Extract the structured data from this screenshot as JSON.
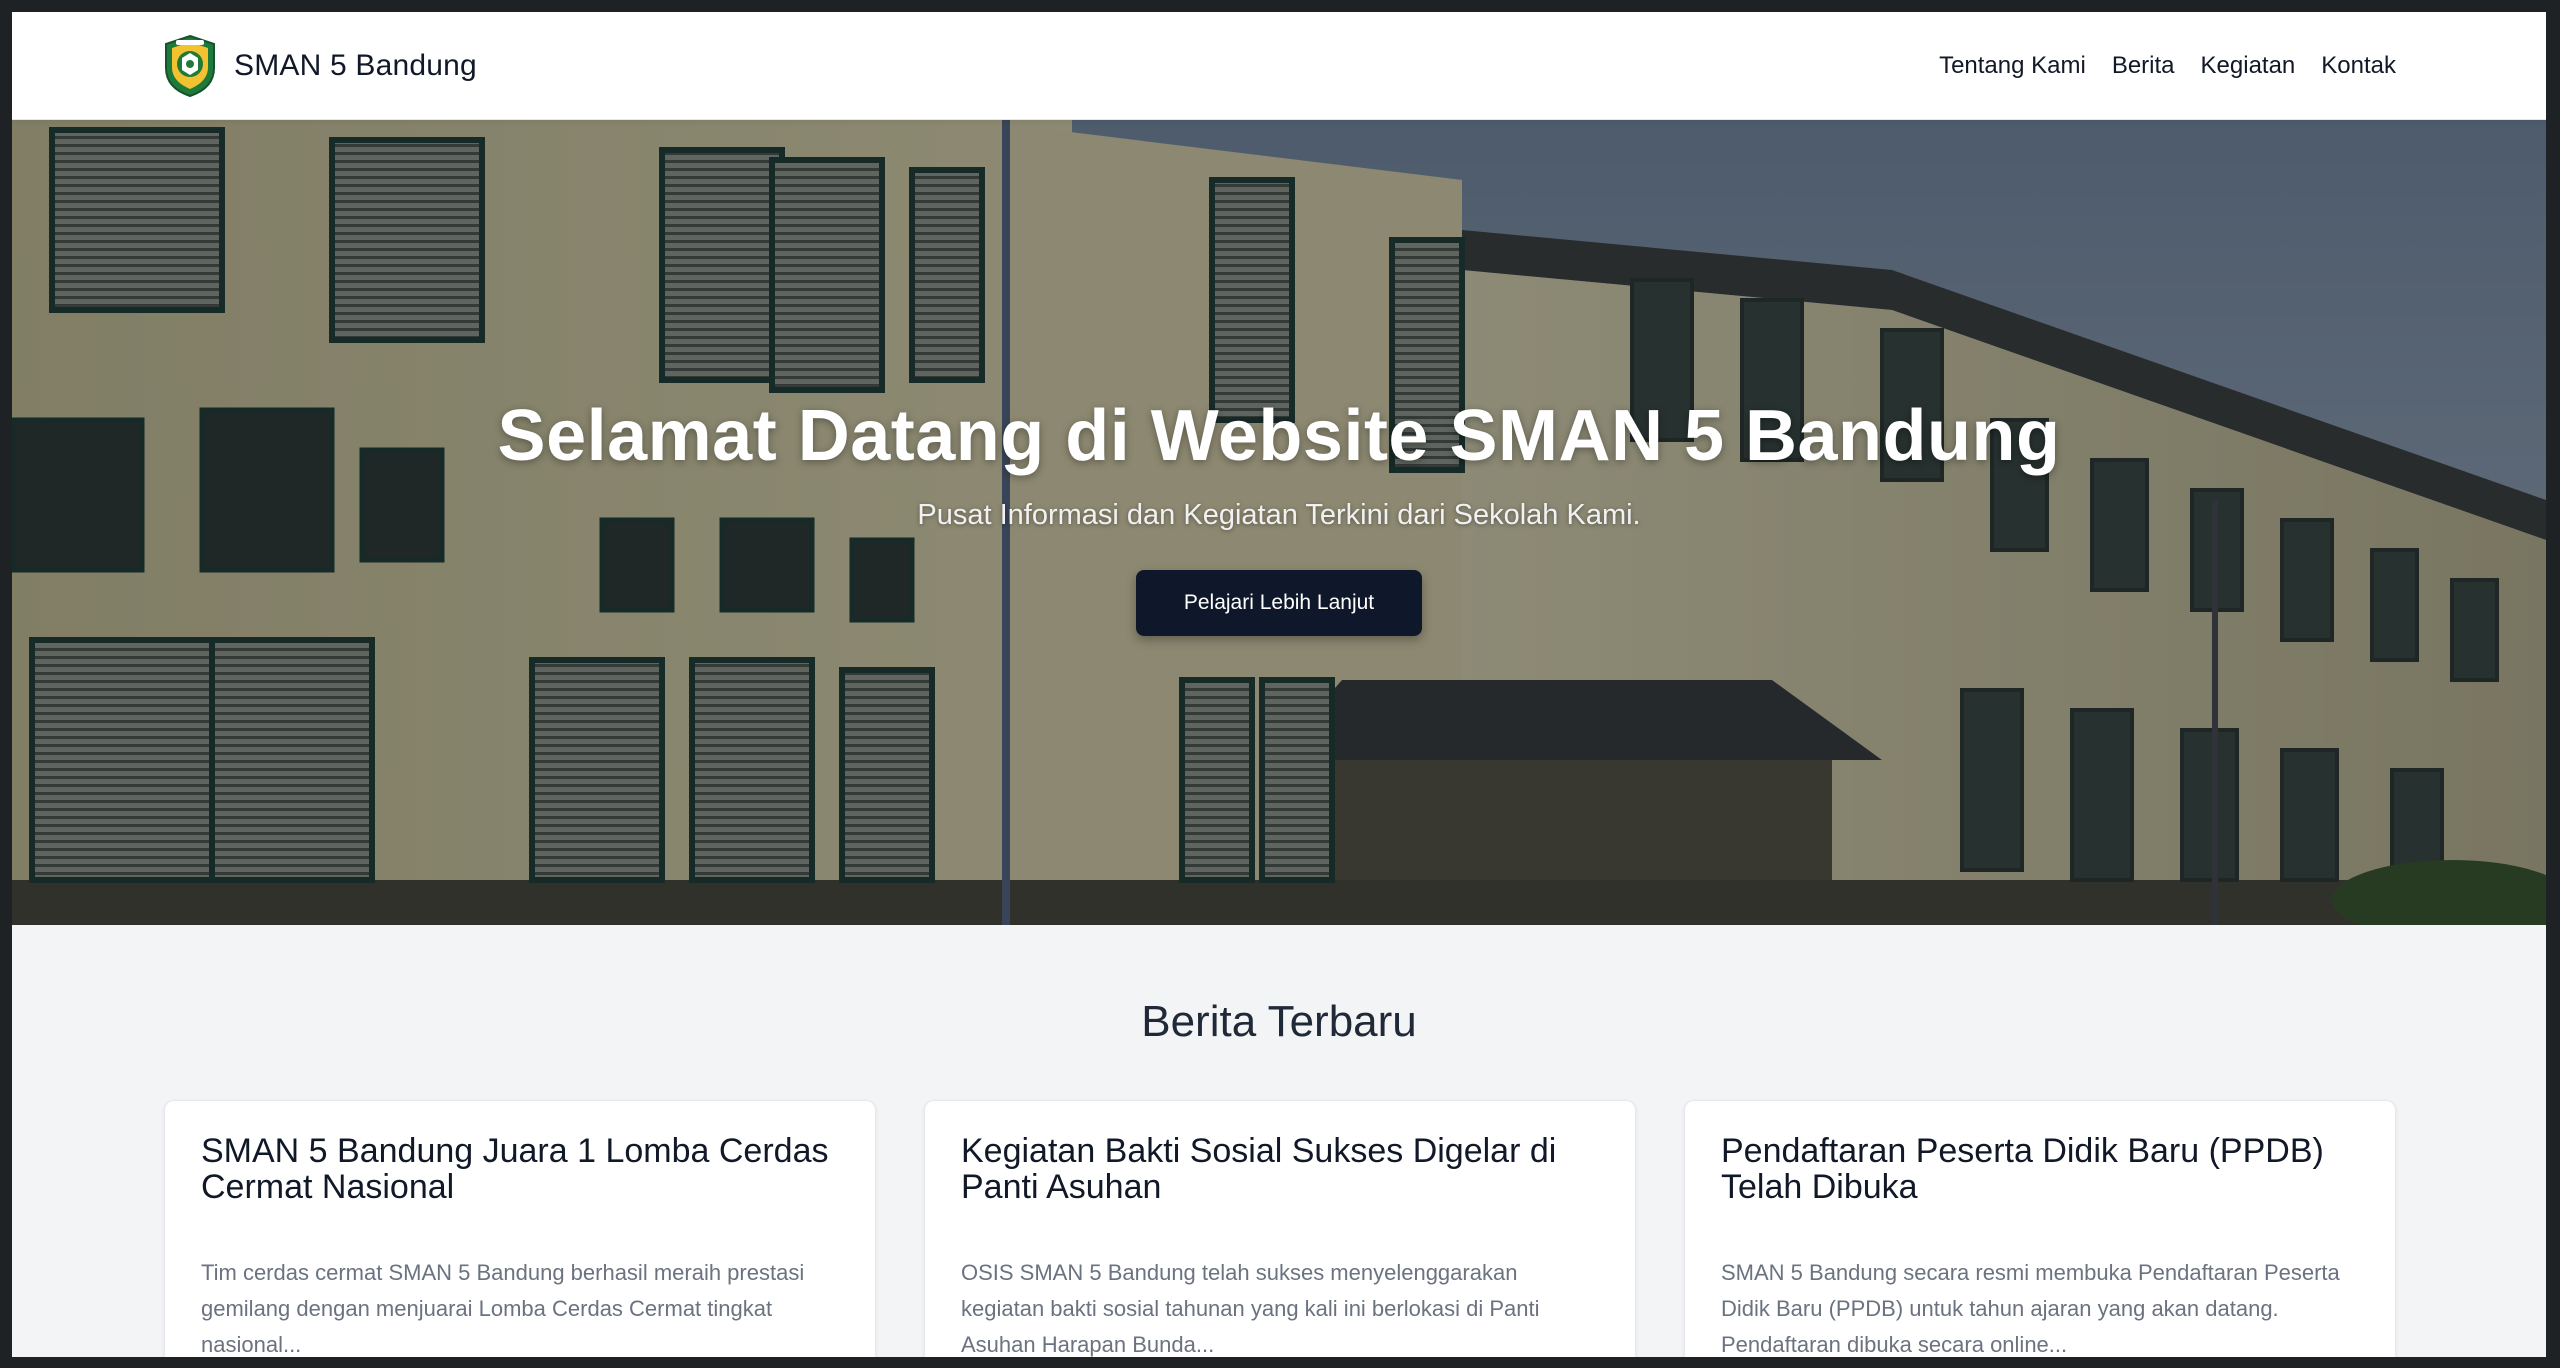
{
  "navbar": {
    "brand_name": "SMAN 5 Bandung",
    "links": [
      "Tentang Kami",
      "Berita",
      "Kegiatan",
      "Kontak"
    ]
  },
  "hero": {
    "title": "Selamat Datang di Website SMAN 5 Bandung",
    "subtitle": "Pusat Informasi dan Kegiatan Terkini dari Sekolah Kami.",
    "button_label": "Pelajari Lebih Lanjut"
  },
  "news": {
    "heading": "Berita Terbaru",
    "articles": [
      {
        "title": "SMAN 5 Bandung Juara 1 Lomba Cerdas Cermat Nasional",
        "excerpt": "Tim cerdas cermat SMAN 5 Bandung berhasil meraih prestasi gemilang dengan menjuarai Lomba Cerdas Cermat tingkat nasional..."
      },
      {
        "title": "Kegiatan Bakti Sosial Sukses Digelar di Panti Asuhan",
        "excerpt": "OSIS SMAN 5 Bandung telah sukses menyelenggarakan kegiatan bakti sosial tahunan yang kali ini berlokasi di Panti Asuhan Harapan Bunda..."
      },
      {
        "title": "Pendaftaran Peserta Didik Baru (PPDB) Telah Dibuka",
        "excerpt": "SMAN 5 Bandung secara resmi membuka Pendaftaran Peserta Didik Baru (PPDB) untuk tahun ajaran yang akan datang. Pendaftaran dibuka secara online..."
      }
    ]
  },
  "colors": {
    "navbar_bg": "#ffffff",
    "hero_button_bg": "#0f172a",
    "section_bg": "#f3f4f6",
    "logo_green": "#1f7a3a",
    "logo_yellow": "#f2c230"
  },
  "icons": {
    "logo": "school-crest-logo"
  }
}
